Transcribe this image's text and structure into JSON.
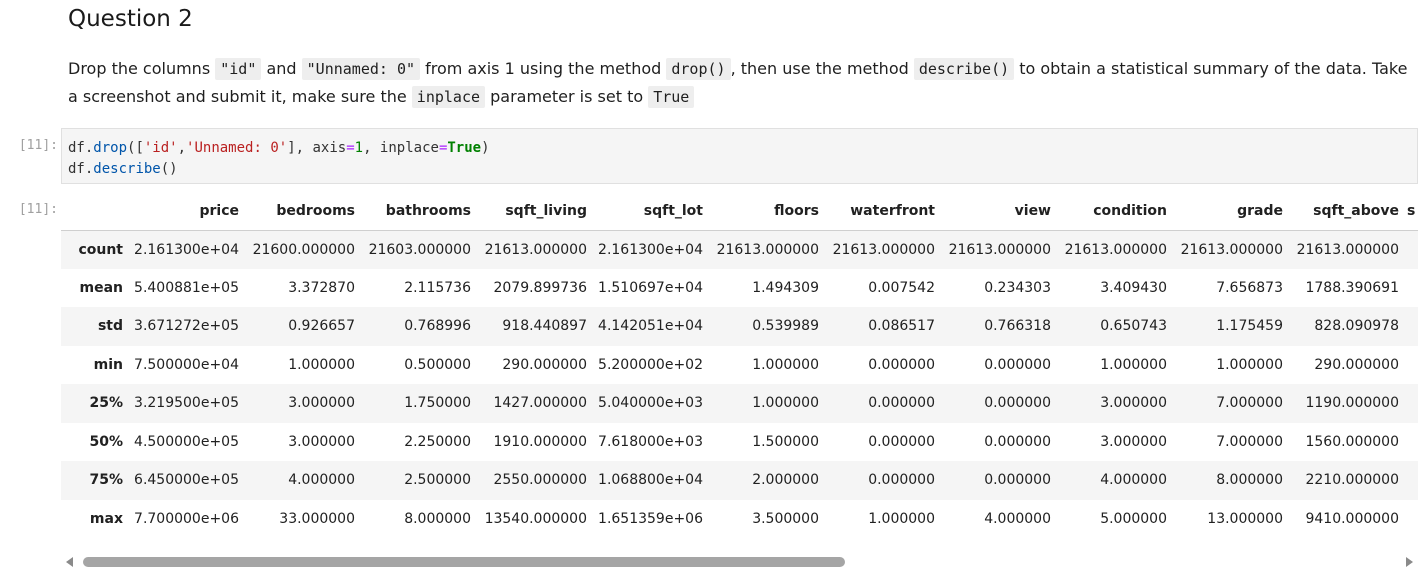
{
  "markdown": {
    "heading": "Question 2",
    "p": {
      "t1": "Drop the columns ",
      "c1": "\"id\"",
      "t2": " and ",
      "c2": "\"Unnamed: 0\"",
      "t3": " from axis 1 using the method ",
      "c3": "drop()",
      "t4": ", then use the method ",
      "c4": "describe()",
      "t5": " to obtain a statistical summary of the data. Take a screenshot and submit it, make sure the ",
      "c5": "inplace",
      "t6": " parameter is set to ",
      "c6": "True"
    }
  },
  "cell": {
    "in_prompt": "[11]:",
    "out_prompt": "[11]:",
    "code": {
      "l1_obj": "df.",
      "l1_fn": "drop",
      "l1_a": "([",
      "l1_s1": "'id'",
      "l1_b": ",",
      "l1_s2": "'Unnamed: 0'",
      "l1_c": "], axis",
      "l1_eq1": "=",
      "l1_n": "1",
      "l1_d": ", inplace",
      "l1_eq2": "=",
      "l1_kw": "True",
      "l1_e": ")",
      "l2_obj": "df.",
      "l2_fn": "describe",
      "l2_a": "()"
    }
  },
  "table": {
    "columns": [
      "",
      "price",
      "bedrooms",
      "bathrooms",
      "sqft_living",
      "sqft_lot",
      "floors",
      "waterfront",
      "view",
      "condition",
      "grade",
      "sqft_above",
      "s"
    ],
    "rows": [
      [
        "count",
        "2.161300e+04",
        "21600.000000",
        "21603.000000",
        "21613.000000",
        "2.161300e+04",
        "21613.000000",
        "21613.000000",
        "21613.000000",
        "21613.000000",
        "21613.000000",
        "21613.000000"
      ],
      [
        "mean",
        "5.400881e+05",
        "3.372870",
        "2.115736",
        "2079.899736",
        "1.510697e+04",
        "1.494309",
        "0.007542",
        "0.234303",
        "3.409430",
        "7.656873",
        "1788.390691"
      ],
      [
        "std",
        "3.671272e+05",
        "0.926657",
        "0.768996",
        "918.440897",
        "4.142051e+04",
        "0.539989",
        "0.086517",
        "0.766318",
        "0.650743",
        "1.175459",
        "828.090978"
      ],
      [
        "min",
        "7.500000e+04",
        "1.000000",
        "0.500000",
        "290.000000",
        "5.200000e+02",
        "1.000000",
        "0.000000",
        "0.000000",
        "1.000000",
        "1.000000",
        "290.000000"
      ],
      [
        "25%",
        "3.219500e+05",
        "3.000000",
        "1.750000",
        "1427.000000",
        "5.040000e+03",
        "1.000000",
        "0.000000",
        "0.000000",
        "3.000000",
        "7.000000",
        "1190.000000"
      ],
      [
        "50%",
        "4.500000e+05",
        "3.000000",
        "2.250000",
        "1910.000000",
        "7.618000e+03",
        "1.500000",
        "0.000000",
        "0.000000",
        "3.000000",
        "7.000000",
        "1560.000000"
      ],
      [
        "75%",
        "6.450000e+05",
        "4.000000",
        "2.500000",
        "2550.000000",
        "1.068800e+04",
        "2.000000",
        "0.000000",
        "0.000000",
        "4.000000",
        "8.000000",
        "2210.000000"
      ],
      [
        "max",
        "7.700000e+06",
        "33.000000",
        "8.000000",
        "13540.000000",
        "1.651359e+06",
        "3.500000",
        "1.000000",
        "4.000000",
        "5.000000",
        "13.000000",
        "9410.000000"
      ]
    ]
  },
  "scrollbar": {
    "position": 0.0,
    "visible_fraction": 0.58
  },
  "icons": {
    "scroll_left": "scroll-left-arrow-icon",
    "scroll_right": "scroll-right-arrow-icon"
  }
}
